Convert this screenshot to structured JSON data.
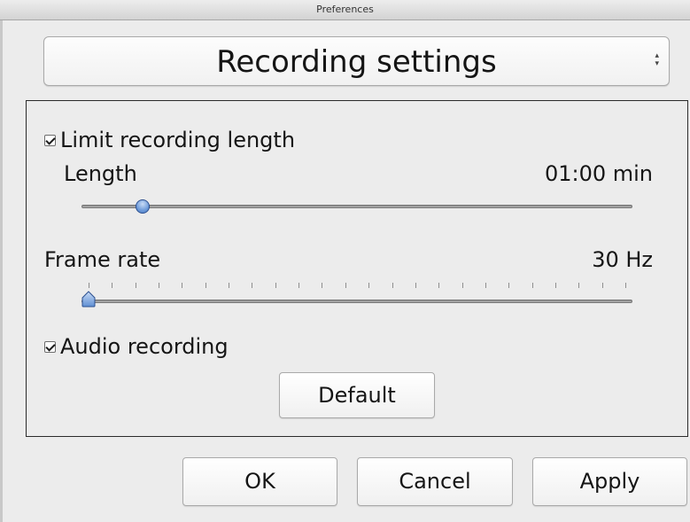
{
  "window": {
    "title": "Preferences"
  },
  "category_popup": {
    "selected": "Recording settings",
    "arrows_icon": "up-down-arrows-icon"
  },
  "limit_length": {
    "label": "Limit recording length",
    "checked": true
  },
  "length": {
    "label": "Length",
    "value_text": "01:00 min",
    "slider_fraction": 0.1
  },
  "frame_rate": {
    "label": "Frame rate",
    "value_text": "30 Hz",
    "slider_fraction": 0.0,
    "tick_count": 24
  },
  "audio_recording": {
    "label": "Audio recording",
    "checked": true
  },
  "buttons": {
    "default": "Default",
    "ok": "OK",
    "cancel": "Cancel",
    "apply": "Apply"
  },
  "colors": {
    "slider_knob": "#6d9ad9",
    "window_bg": "#ececec"
  }
}
